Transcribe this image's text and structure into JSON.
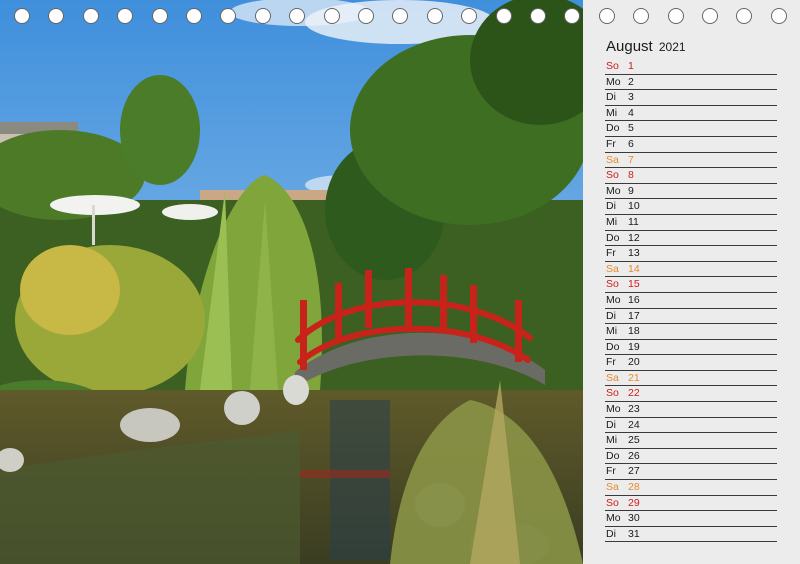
{
  "calendar": {
    "month": "August",
    "year": "2021",
    "days": [
      {
        "wd": "So",
        "num": "1",
        "kind": "sun"
      },
      {
        "wd": "Mo",
        "num": "2",
        "kind": "weekday"
      },
      {
        "wd": "Di",
        "num": "3",
        "kind": "weekday"
      },
      {
        "wd": "Mi",
        "num": "4",
        "kind": "weekday"
      },
      {
        "wd": "Do",
        "num": "5",
        "kind": "weekday"
      },
      {
        "wd": "Fr",
        "num": "6",
        "kind": "weekday"
      },
      {
        "wd": "Sa",
        "num": "7",
        "kind": "sat"
      },
      {
        "wd": "So",
        "num": "8",
        "kind": "sun"
      },
      {
        "wd": "Mo",
        "num": "9",
        "kind": "weekday"
      },
      {
        "wd": "Di",
        "num": "10",
        "kind": "weekday"
      },
      {
        "wd": "Mi",
        "num": "11",
        "kind": "weekday"
      },
      {
        "wd": "Do",
        "num": "12",
        "kind": "weekday"
      },
      {
        "wd": "Fr",
        "num": "13",
        "kind": "weekday"
      },
      {
        "wd": "Sa",
        "num": "14",
        "kind": "sat"
      },
      {
        "wd": "So",
        "num": "15",
        "kind": "sun"
      },
      {
        "wd": "Mo",
        "num": "16",
        "kind": "weekday"
      },
      {
        "wd": "Di",
        "num": "17",
        "kind": "weekday"
      },
      {
        "wd": "Mi",
        "num": "18",
        "kind": "weekday"
      },
      {
        "wd": "Do",
        "num": "19",
        "kind": "weekday"
      },
      {
        "wd": "Fr",
        "num": "20",
        "kind": "weekday"
      },
      {
        "wd": "Sa",
        "num": "21",
        "kind": "sat"
      },
      {
        "wd": "So",
        "num": "22",
        "kind": "sun"
      },
      {
        "wd": "Mo",
        "num": "23",
        "kind": "weekday"
      },
      {
        "wd": "Di",
        "num": "24",
        "kind": "weekday"
      },
      {
        "wd": "Mi",
        "num": "25",
        "kind": "weekday"
      },
      {
        "wd": "Do",
        "num": "26",
        "kind": "weekday"
      },
      {
        "wd": "Fr",
        "num": "27",
        "kind": "weekday"
      },
      {
        "wd": "Sa",
        "num": "28",
        "kind": "sat"
      },
      {
        "wd": "So",
        "num": "29",
        "kind": "sun"
      },
      {
        "wd": "Mo",
        "num": "30",
        "kind": "weekday"
      },
      {
        "wd": "Di",
        "num": "31",
        "kind": "weekday"
      }
    ]
  },
  "colors": {
    "sunday": "#d01c1c",
    "saturday": "#e88a2c",
    "weekday": "#1a1a1a",
    "panel_background": "#ececec"
  }
}
